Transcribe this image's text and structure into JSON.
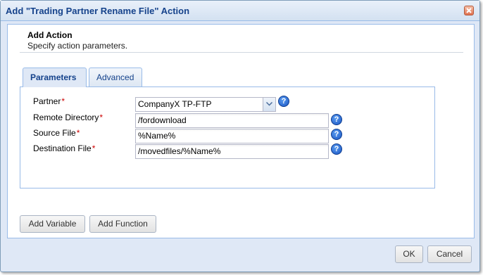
{
  "window": {
    "title": "Add \"Trading Partner Rename File\" Action"
  },
  "header": {
    "title": "Add Action",
    "subtitle": "Specify action parameters."
  },
  "tabs": [
    {
      "label": "Parameters",
      "active": true
    },
    {
      "label": "Advanced",
      "active": false
    }
  ],
  "form": {
    "partner": {
      "label": "Partner",
      "value": "CompanyX TP-FTP",
      "required": true
    },
    "remote_directory": {
      "label": "Remote Directory",
      "value": "/fordownload",
      "required": true
    },
    "source_file": {
      "label": "Source File",
      "value": "%Name%",
      "required": true
    },
    "destination_file": {
      "label": "Destination File",
      "value": "/movedfiles/%Name%",
      "required": true
    },
    "required_marker": "*",
    "help_glyph": "?"
  },
  "buttons": {
    "add_variable": "Add Variable",
    "add_function": "Add Function",
    "ok": "OK",
    "cancel": "Cancel"
  },
  "icons": {
    "close": "close-icon",
    "help": "help-icon",
    "dropdown": "chevron-down-icon"
  },
  "colors": {
    "title_text": "#15428b",
    "required": "#cc0000",
    "help_icon": "#1a56c4",
    "dialog_bg": "#dfe8f6",
    "border": "#99bbe8"
  }
}
